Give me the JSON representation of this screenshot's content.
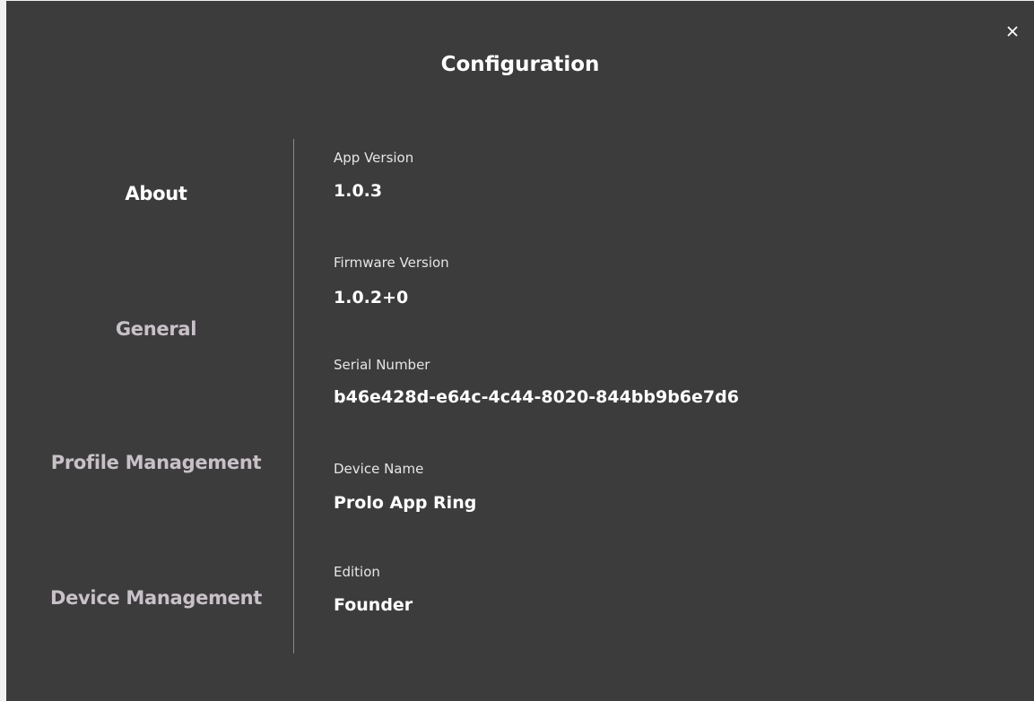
{
  "dialog": {
    "title": "Configuration",
    "close_glyph": "✕"
  },
  "sidebar": {
    "items": [
      {
        "label": "About",
        "active": true
      },
      {
        "label": "General",
        "active": false
      },
      {
        "label": "Profile Management",
        "active": false
      },
      {
        "label": "Device Management",
        "active": false
      }
    ]
  },
  "about": {
    "fields": [
      {
        "label": "App Version",
        "value": "1.0.3"
      },
      {
        "label": "Firmware Version",
        "value": "1.0.2+0"
      },
      {
        "label": "Serial Number",
        "value": "b46e428d-e64c-4c44-8020-844bb9b6e7d6"
      },
      {
        "label": "Device Name",
        "value": "Prolo App Ring"
      },
      {
        "label": "Edition",
        "value": "Founder"
      }
    ]
  },
  "colors": {
    "dialog_background": "#3c3c3c",
    "active_text": "#ffffff",
    "inactive_text": "#c8c1c8",
    "divider": "#8a8a8a"
  }
}
